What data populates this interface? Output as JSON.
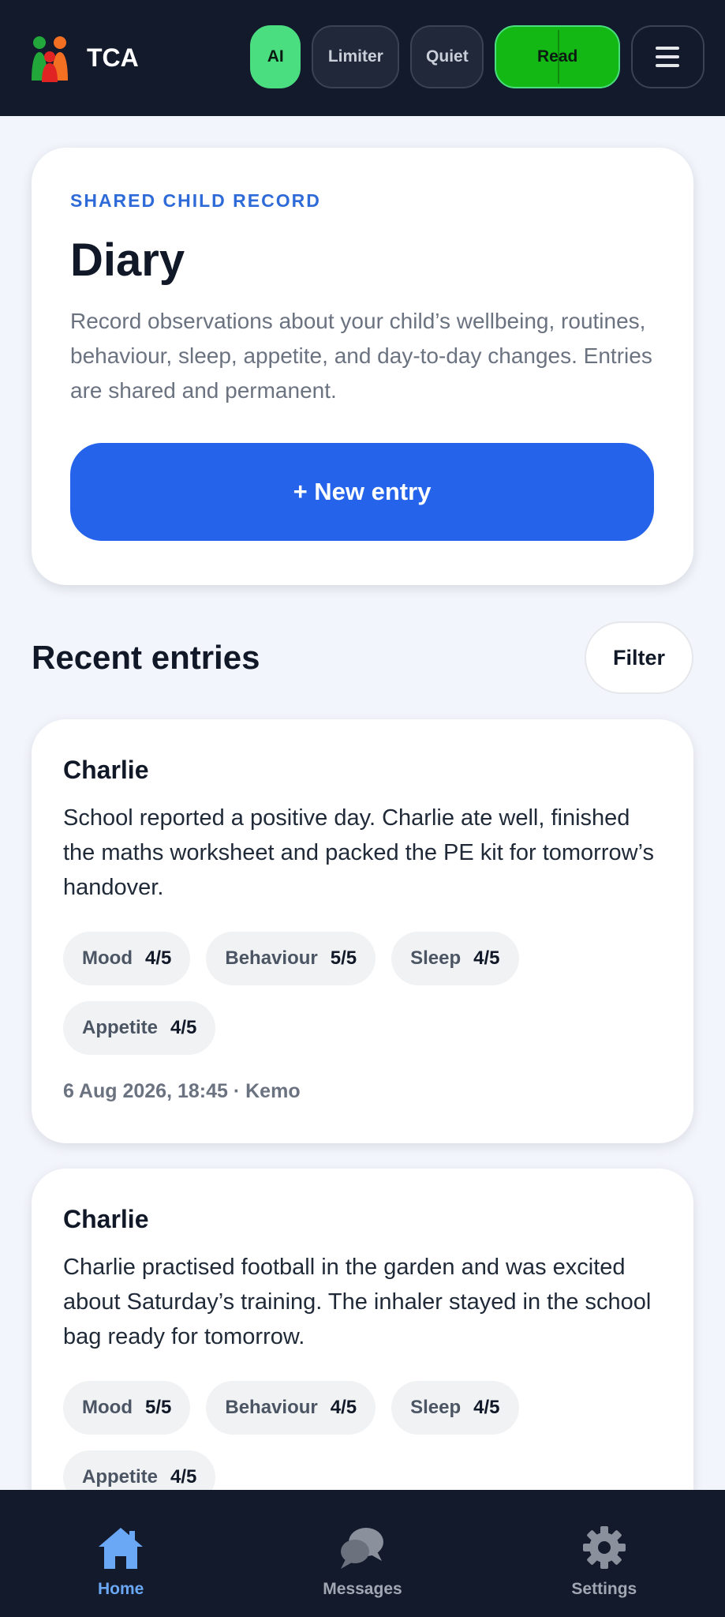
{
  "header": {
    "brand": "TCA",
    "buttons": {
      "ai": "AI",
      "limiter": "Limiter",
      "quiet": "Quiet",
      "read": "Read"
    }
  },
  "hero": {
    "eyebrow": "SHARED CHILD RECORD",
    "title": "Diary",
    "description": "Record observations about your child’s wellbeing, routines, behaviour, sleep, appetite, and day-to-day changes. Entries are shared and permanent.",
    "new_entry_label": "+ New entry"
  },
  "recent": {
    "heading": "Recent entries",
    "filter_label": "Filter"
  },
  "entries": [
    {
      "name": "Charlie",
      "text": "School reported a positive day. Charlie ate well, finished the maths worksheet and packed the PE kit for tomorrow’s handover.",
      "tags": [
        {
          "label": "Mood",
          "value": "4/5"
        },
        {
          "label": "Behaviour",
          "value": "5/5"
        },
        {
          "label": "Sleep",
          "value": "4/5"
        },
        {
          "label": "Appetite",
          "value": "4/5"
        }
      ],
      "meta": "6 Aug 2026, 18:45 · Kemo"
    },
    {
      "name": "Charlie",
      "text": "Charlie practised football in the garden and was excited about Saturday’s training. The inhaler stayed in the school bag ready for tomorrow.",
      "tags": [
        {
          "label": "Mood",
          "value": "5/5"
        },
        {
          "label": "Behaviour",
          "value": "4/5"
        },
        {
          "label": "Sleep",
          "value": "4/5"
        },
        {
          "label": "Appetite",
          "value": "4/5"
        }
      ]
    }
  ],
  "bottom_nav": {
    "home": "Home",
    "messages": "Messages",
    "settings": "Settings"
  },
  "colors": {
    "primary": "#2563eb",
    "ai_active": "#4ade80",
    "read_active": "#14b814",
    "nav_active": "#6aa8f5",
    "header_bg": "#131a2b"
  },
  "icons": {
    "logo": "family-logo-icon",
    "menu": "hamburger-menu-icon",
    "home": "home-icon",
    "messages": "chat-bubbles-icon",
    "settings": "gear-icon"
  }
}
